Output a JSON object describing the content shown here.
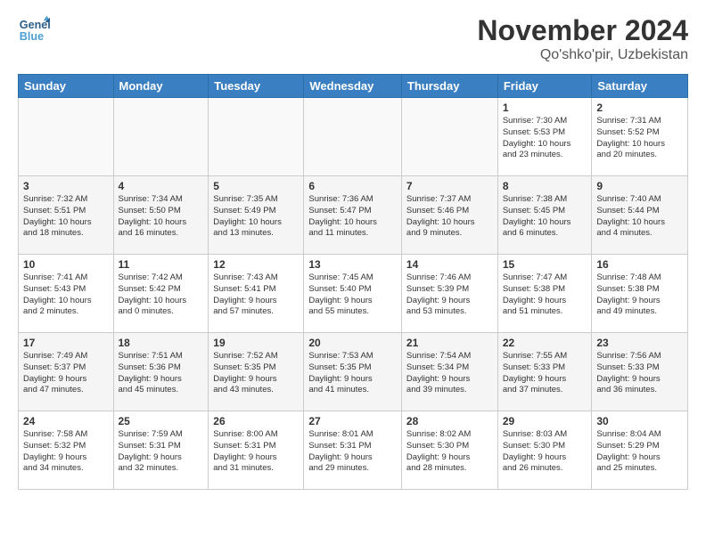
{
  "header": {
    "logo_line1": "General",
    "logo_line2": "Blue",
    "month": "November 2024",
    "location": "Qo'shko'pir, Uzbekistan"
  },
  "days_of_week": [
    "Sunday",
    "Monday",
    "Tuesday",
    "Wednesday",
    "Thursday",
    "Friday",
    "Saturday"
  ],
  "weeks": [
    [
      {
        "day": "",
        "info": ""
      },
      {
        "day": "",
        "info": ""
      },
      {
        "day": "",
        "info": ""
      },
      {
        "day": "",
        "info": ""
      },
      {
        "day": "",
        "info": ""
      },
      {
        "day": "1",
        "info": "Sunrise: 7:30 AM\nSunset: 5:53 PM\nDaylight: 10 hours\nand 23 minutes."
      },
      {
        "day": "2",
        "info": "Sunrise: 7:31 AM\nSunset: 5:52 PM\nDaylight: 10 hours\nand 20 minutes."
      }
    ],
    [
      {
        "day": "3",
        "info": "Sunrise: 7:32 AM\nSunset: 5:51 PM\nDaylight: 10 hours\nand 18 minutes."
      },
      {
        "day": "4",
        "info": "Sunrise: 7:34 AM\nSunset: 5:50 PM\nDaylight: 10 hours\nand 16 minutes."
      },
      {
        "day": "5",
        "info": "Sunrise: 7:35 AM\nSunset: 5:49 PM\nDaylight: 10 hours\nand 13 minutes."
      },
      {
        "day": "6",
        "info": "Sunrise: 7:36 AM\nSunset: 5:47 PM\nDaylight: 10 hours\nand 11 minutes."
      },
      {
        "day": "7",
        "info": "Sunrise: 7:37 AM\nSunset: 5:46 PM\nDaylight: 10 hours\nand 9 minutes."
      },
      {
        "day": "8",
        "info": "Sunrise: 7:38 AM\nSunset: 5:45 PM\nDaylight: 10 hours\nand 6 minutes."
      },
      {
        "day": "9",
        "info": "Sunrise: 7:40 AM\nSunset: 5:44 PM\nDaylight: 10 hours\nand 4 minutes."
      }
    ],
    [
      {
        "day": "10",
        "info": "Sunrise: 7:41 AM\nSunset: 5:43 PM\nDaylight: 10 hours\nand 2 minutes."
      },
      {
        "day": "11",
        "info": "Sunrise: 7:42 AM\nSunset: 5:42 PM\nDaylight: 10 hours\nand 0 minutes."
      },
      {
        "day": "12",
        "info": "Sunrise: 7:43 AM\nSunset: 5:41 PM\nDaylight: 9 hours\nand 57 minutes."
      },
      {
        "day": "13",
        "info": "Sunrise: 7:45 AM\nSunset: 5:40 PM\nDaylight: 9 hours\nand 55 minutes."
      },
      {
        "day": "14",
        "info": "Sunrise: 7:46 AM\nSunset: 5:39 PM\nDaylight: 9 hours\nand 53 minutes."
      },
      {
        "day": "15",
        "info": "Sunrise: 7:47 AM\nSunset: 5:38 PM\nDaylight: 9 hours\nand 51 minutes."
      },
      {
        "day": "16",
        "info": "Sunrise: 7:48 AM\nSunset: 5:38 PM\nDaylight: 9 hours\nand 49 minutes."
      }
    ],
    [
      {
        "day": "17",
        "info": "Sunrise: 7:49 AM\nSunset: 5:37 PM\nDaylight: 9 hours\nand 47 minutes."
      },
      {
        "day": "18",
        "info": "Sunrise: 7:51 AM\nSunset: 5:36 PM\nDaylight: 9 hours\nand 45 minutes."
      },
      {
        "day": "19",
        "info": "Sunrise: 7:52 AM\nSunset: 5:35 PM\nDaylight: 9 hours\nand 43 minutes."
      },
      {
        "day": "20",
        "info": "Sunrise: 7:53 AM\nSunset: 5:35 PM\nDaylight: 9 hours\nand 41 minutes."
      },
      {
        "day": "21",
        "info": "Sunrise: 7:54 AM\nSunset: 5:34 PM\nDaylight: 9 hours\nand 39 minutes."
      },
      {
        "day": "22",
        "info": "Sunrise: 7:55 AM\nSunset: 5:33 PM\nDaylight: 9 hours\nand 37 minutes."
      },
      {
        "day": "23",
        "info": "Sunrise: 7:56 AM\nSunset: 5:33 PM\nDaylight: 9 hours\nand 36 minutes."
      }
    ],
    [
      {
        "day": "24",
        "info": "Sunrise: 7:58 AM\nSunset: 5:32 PM\nDaylight: 9 hours\nand 34 minutes."
      },
      {
        "day": "25",
        "info": "Sunrise: 7:59 AM\nSunset: 5:31 PM\nDaylight: 9 hours\nand 32 minutes."
      },
      {
        "day": "26",
        "info": "Sunrise: 8:00 AM\nSunset: 5:31 PM\nDaylight: 9 hours\nand 31 minutes."
      },
      {
        "day": "27",
        "info": "Sunrise: 8:01 AM\nSunset: 5:31 PM\nDaylight: 9 hours\nand 29 minutes."
      },
      {
        "day": "28",
        "info": "Sunrise: 8:02 AM\nSunset: 5:30 PM\nDaylight: 9 hours\nand 28 minutes."
      },
      {
        "day": "29",
        "info": "Sunrise: 8:03 AM\nSunset: 5:30 PM\nDaylight: 9 hours\nand 26 minutes."
      },
      {
        "day": "30",
        "info": "Sunrise: 8:04 AM\nSunset: 5:29 PM\nDaylight: 9 hours\nand 25 minutes."
      }
    ]
  ]
}
